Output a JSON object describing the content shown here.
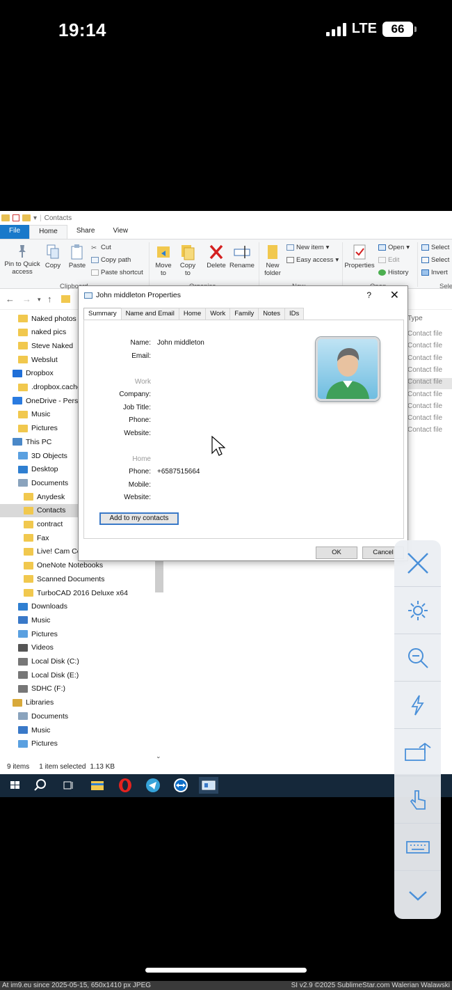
{
  "phone": {
    "time": "19:14",
    "network": "LTE",
    "battery": "66"
  },
  "explorer": {
    "qat_title": "Contacts",
    "tabs": [
      "File",
      "Home",
      "Share",
      "View"
    ],
    "ribbon": {
      "pin": "Pin to Quick access",
      "copy": "Copy",
      "paste": "Paste",
      "cut": "Cut",
      "copy_path": "Copy path",
      "paste_shortcut": "Paste shortcut",
      "clipboard": "Clipboard",
      "move_to": "Move to",
      "copy_to": "Copy to",
      "delete": "Delete",
      "rename": "Rename",
      "organise": "Organise",
      "new_folder": "New folder",
      "new_item": "New item",
      "easy_access": "Easy access",
      "new": "New",
      "properties": "Properties",
      "open": "Open",
      "edit": "Edit",
      "history": "History",
      "open_group": "Open",
      "select_all": "Select",
      "select_none": "Select",
      "invert": "Invert",
      "select_group": "Sele"
    },
    "nav": [
      {
        "label": "Naked photos",
        "indent": 1,
        "icon": "folder-icon"
      },
      {
        "label": "naked pics",
        "indent": 1,
        "icon": "folder-icon"
      },
      {
        "label": "Steve Naked",
        "indent": 1,
        "icon": "folder-icon"
      },
      {
        "label": "Webslut",
        "indent": 1,
        "icon": "folder-icon"
      },
      {
        "label": "Dropbox",
        "indent": 0,
        "icon": "dropbox-icon"
      },
      {
        "label": ".dropbox.cache",
        "indent": 1,
        "icon": "folder-icon"
      },
      {
        "label": "OneDrive - Perso",
        "indent": 0,
        "icon": "onedrive-icon"
      },
      {
        "label": "Music",
        "indent": 1,
        "icon": "folder-icon"
      },
      {
        "label": "Pictures",
        "indent": 1,
        "icon": "folder-icon"
      },
      {
        "label": "This PC",
        "indent": 0,
        "icon": "pc-icon"
      },
      {
        "label": "3D Objects",
        "indent": 1,
        "icon": "cube-icon"
      },
      {
        "label": "Desktop",
        "indent": 1,
        "icon": "desktop-icon"
      },
      {
        "label": "Documents",
        "indent": 1,
        "icon": "documents-icon"
      },
      {
        "label": "Anydesk",
        "indent": 2,
        "icon": "folder-icon"
      },
      {
        "label": "Contacts",
        "indent": 2,
        "icon": "folder-icon",
        "selected": true
      },
      {
        "label": "contract",
        "indent": 2,
        "icon": "folder-icon"
      },
      {
        "label": "Fax",
        "indent": 2,
        "icon": "folder-icon"
      },
      {
        "label": "Live! Cam Center",
        "indent": 2,
        "icon": "folder-icon"
      },
      {
        "label": "OneNote Notebooks",
        "indent": 2,
        "icon": "folder-icon"
      },
      {
        "label": "Scanned Documents",
        "indent": 2,
        "icon": "folder-icon"
      },
      {
        "label": "TurboCAD 2016 Deluxe x64",
        "indent": 2,
        "icon": "folder-icon"
      },
      {
        "label": "Downloads",
        "indent": 1,
        "icon": "download-icon"
      },
      {
        "label": "Music",
        "indent": 1,
        "icon": "music-icon"
      },
      {
        "label": "Pictures",
        "indent": 1,
        "icon": "pictures-icon"
      },
      {
        "label": "Videos",
        "indent": 1,
        "icon": "videos-icon"
      },
      {
        "label": "Local Disk (C:)",
        "indent": 1,
        "icon": "disk-icon"
      },
      {
        "label": "Local Disk (E:)",
        "indent": 1,
        "icon": "disk-icon"
      },
      {
        "label": "SDHC (F:)",
        "indent": 1,
        "icon": "disk-icon"
      },
      {
        "label": "Libraries",
        "indent": 0,
        "icon": "libraries-icon"
      },
      {
        "label": "Documents",
        "indent": 1,
        "icon": "documents-icon"
      },
      {
        "label": "Music",
        "indent": 1,
        "icon": "music-icon"
      },
      {
        "label": "Pictures",
        "indent": 1,
        "icon": "pictures-icon"
      }
    ],
    "column_type": "Type",
    "file_types": [
      "Contact file",
      "Contact file",
      "Contact file",
      "Contact file",
      "Contact file",
      "Contact file",
      "Contact file",
      "Contact file",
      "Contact file"
    ],
    "status": {
      "items": "9 items",
      "selected": "1 item selected",
      "size": "1.13 KB"
    }
  },
  "dialog": {
    "title": "John middleton Properties",
    "help": "?",
    "close": "✕",
    "tabs": [
      "Summary",
      "Name and Email",
      "Home",
      "Work",
      "Family",
      "Notes",
      "IDs"
    ],
    "fields": {
      "name_label": "Name:",
      "name_value": "John middleton",
      "email_label": "Email:",
      "work_section": "Work",
      "company_label": "Company:",
      "jobtitle_label": "Job Title:",
      "work_phone_label": "Phone:",
      "work_website_label": "Website:",
      "home_section": "Home",
      "home_phone_label": "Phone:",
      "home_phone_value": "+6587515664",
      "mobile_label": "Mobile:",
      "home_website_label": "Website:"
    },
    "add_button": "Add to my contacts",
    "ok": "OK",
    "cancel": "Cancel"
  },
  "footer": {
    "left": "At im9.eu since 2025-05-15, 650x1410 px JPEG",
    "right": "SI v2.9 ©2025 SublimeStar.com Walerian Walawski"
  }
}
